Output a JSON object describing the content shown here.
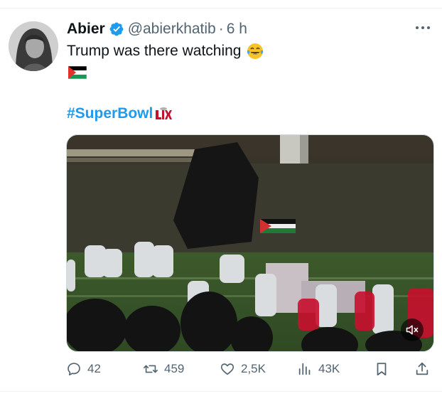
{
  "tweet": {
    "author": {
      "display_name": "Abier",
      "handle": "@abierkhatib",
      "verified": true
    },
    "time_separator": "·",
    "time": "6 h",
    "text": "Trump was there watching",
    "text_emoji": "face-with-tears-of-joy-icon",
    "flag": "palestine-flag-icon",
    "hashtag": "#SuperBowl",
    "hashtag_logo": "super-bowl-lix-logo",
    "media": {
      "type": "video",
      "muted": true
    },
    "stats": {
      "replies": "42",
      "reposts": "459",
      "likes": "2,5K",
      "views": "43K"
    }
  },
  "colors": {
    "link": "#1d9bf0",
    "secondary_text": "#536471",
    "primary_text": "#0f1419",
    "verified": "#1d9bf0"
  }
}
